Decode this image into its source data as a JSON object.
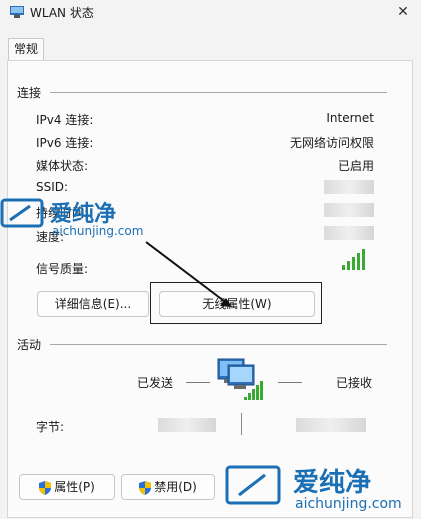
{
  "window": {
    "title": "WLAN 状态",
    "close_glyph": "✕"
  },
  "tabs": [
    {
      "label": "常规"
    }
  ],
  "connection": {
    "title": "连接",
    "rows": [
      {
        "label": "IPv4 连接:",
        "value": "Internet"
      },
      {
        "label": "IPv6 连接:",
        "value": "无网络访问权限"
      },
      {
        "label": "媒体状态:",
        "value": "已启用"
      },
      {
        "label": "SSID:",
        "value": ""
      },
      {
        "label": "持续时间:",
        "value": ""
      },
      {
        "label": "速度:",
        "value": ""
      },
      {
        "label": "信号质量:",
        "value": ""
      }
    ],
    "signal_level": 1.0
  },
  "buttons": {
    "details": "详细信息(E)...",
    "wireless_props": "无线属性(W)",
    "properties": "属性(P)",
    "disable": "禁用(D)"
  },
  "activity": {
    "title": "活动",
    "sent_label": "已发送",
    "received_label": "已接收",
    "bytes_label": "字节:",
    "bytes_sent": "",
    "bytes_received": ""
  },
  "watermark": {
    "brand": "爱纯净",
    "url": "aichunjing.com"
  },
  "colors": {
    "signal_green": "#3aaa35",
    "watermark_blue": "#1b6fb5",
    "shield_blue": "#2a6fdb",
    "shield_yellow": "#f2c200"
  },
  "icons": {
    "app": "wlan-status-icon",
    "network": "network-computers-icon",
    "shield": "uac-shield-icon",
    "annotation": "arrow-annotation"
  }
}
